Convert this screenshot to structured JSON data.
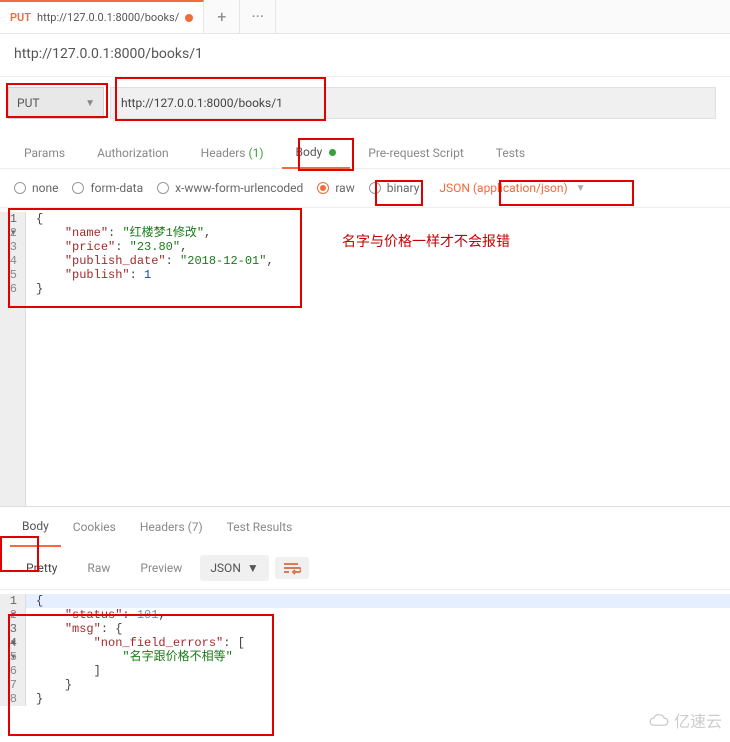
{
  "tab": {
    "method": "PUT",
    "url_short": "http://127.0.0.1:8000/books/"
  },
  "title": "http://127.0.0.1:8000/books/1",
  "request": {
    "method": "PUT",
    "url": "http://127.0.0.1:8000/books/1"
  },
  "req_tabs": {
    "params": "Params",
    "authorization": "Authorization",
    "headers": "Headers",
    "headers_count": "(1)",
    "body": "Body",
    "pre_request": "Pre-request Script",
    "tests": "Tests"
  },
  "body_opts": {
    "none": "none",
    "form_data": "form-data",
    "x_www": "x-www-form-urlencoded",
    "raw": "raw",
    "binary": "binary",
    "content_type": "JSON (application/json)"
  },
  "req_body_lines": {
    "l1": "{",
    "l2_k": "\"name\"",
    "l2_v": "\"红楼梦1修改\"",
    "l3_k": "\"price\"",
    "l3_v": "\"23.80\"",
    "l4_k": "\"publish_date\"",
    "l4_v": "\"2018-12-01\"",
    "l5_k": "\"publish\"",
    "l5_v": "1",
    "l6": "}"
  },
  "annotation_text": "名字与价格一样才不会报错",
  "resp_tabs": {
    "body": "Body",
    "cookies": "Cookies",
    "headers": "Headers",
    "headers_count": "(7)",
    "test_results": "Test Results"
  },
  "resp_view": {
    "pretty": "Pretty",
    "raw": "Raw",
    "preview": "Preview",
    "format": "JSON"
  },
  "resp_body_lines": {
    "l1": "{",
    "l2_k": "\"status\"",
    "l2_v": "101",
    "l3_k": "\"msg\"",
    "l4_k": "\"non_field_errors\"",
    "l5_v": "\"名字跟价格不相等\"",
    "l8": "}"
  },
  "watermark": "亿速云"
}
